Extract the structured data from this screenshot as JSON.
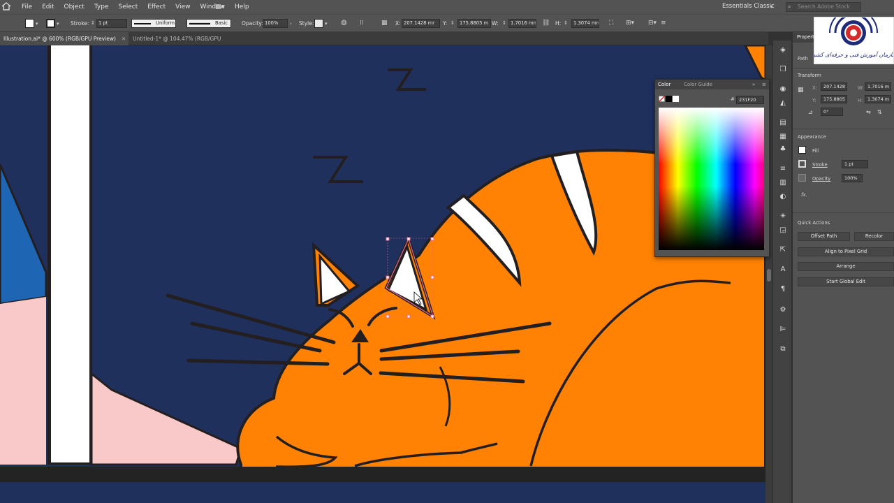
{
  "menubar": {
    "items": [
      "File",
      "Edit",
      "Object",
      "Type",
      "Select",
      "Effect",
      "View",
      "Window",
      "Help"
    ],
    "workspace": "Essentials Classic",
    "search_placeholder": "Search Adobe Stock"
  },
  "controlbar": {
    "stroke_label": "Stroke:",
    "stroke_value": "1 pt",
    "profile": "Uniform",
    "brush": "Basic",
    "opacity_label": "Opacity:",
    "opacity_value": "100%",
    "style_label": "Style:",
    "x_label": "X:",
    "x_value": "207.1428 mr",
    "y_label": "Y:",
    "y_value": "175.8805 m",
    "w_label": "W:",
    "w_value": "1.7016 mm",
    "h_label": "H:",
    "h_value": "1.3074 mm"
  },
  "tabs": [
    {
      "label": "Illustration.ai* @ 600% (RGB/GPU Preview)",
      "close": "✕"
    },
    {
      "label": "Untitled-1* @ 104.47% (RGB/GPU Preview)",
      "close": "✕"
    }
  ],
  "properties": {
    "title": "Propert",
    "object_type": "Path",
    "transform_title": "Transform",
    "x_label": "X:",
    "x_value": "207.1428 m",
    "y_label": "Y:",
    "y_value": "175.8805 m",
    "w_label": "W:",
    "w_value": "1.7016 m",
    "h_label": "H:",
    "h_value": "1.3074 m",
    "angle_value": "0°",
    "appearance_title": "Appearance",
    "fill_label": "Fill",
    "stroke_label": "Stroke",
    "stroke_value": "1 pt",
    "opacity_label": "Opacity",
    "opacity_value": "100%",
    "fx_label": "fx.",
    "quick_actions_title": "Quick Actions",
    "offset_path": "Offset Path",
    "recolor": "Recolor",
    "align_pixel": "Align to Pixel Grid",
    "arrange": "Arrange",
    "global_edit": "Start Global Edit"
  },
  "color_panel": {
    "tab_color": "Color",
    "tab_guide": "Color Guide",
    "hex_symbol": "#",
    "hex_value": "231F20"
  },
  "logo": {
    "caption": "سازمان آموزش فنی و حرفه‌ای کشور",
    "colors": {
      "red": "#d42a2a",
      "blue": "#1e2a7a"
    }
  },
  "artwork": {
    "zzz": [
      "Z",
      "Z"
    ],
    "colors": {
      "night": "#20305d",
      "cat": "#ff8205",
      "outline": "#231f20",
      "wall_pink": "#f9c9c9",
      "window_blue": "#1e66b4",
      "window_frame": "#ffffff",
      "floor": "#232323",
      "selection": "#e26a8f"
    }
  }
}
